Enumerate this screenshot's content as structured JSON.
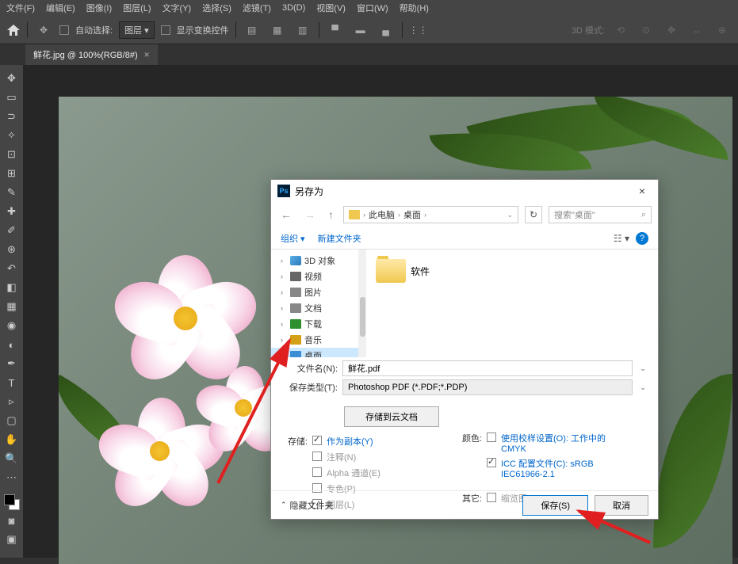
{
  "menubar": [
    "文件(F)",
    "编辑(E)",
    "图像(I)",
    "图层(L)",
    "文字(Y)",
    "选择(S)",
    "滤镜(T)",
    "3D(D)",
    "视图(V)",
    "窗口(W)",
    "帮助(H)"
  ],
  "toolbar": {
    "auto_select_label": "自动选择:",
    "layer_select": "图层",
    "show_transform": "显示变换控件",
    "mode_3d": "3D 模式:"
  },
  "document_tab": "鲜花.jpg @ 100%(RGB/8#)",
  "dialog": {
    "title": "另存为",
    "path": {
      "segments": [
        "此电脑",
        "桌面"
      ]
    },
    "search_placeholder": "搜索\"桌面\"",
    "organize": "组织",
    "new_folder": "新建文件夹",
    "tree": [
      {
        "label": "3D 对象",
        "icon": "ti-3d"
      },
      {
        "label": "视频",
        "icon": "ti-video"
      },
      {
        "label": "图片",
        "icon": "ti-pic"
      },
      {
        "label": "文档",
        "icon": "ti-doc"
      },
      {
        "label": "下载",
        "icon": "ti-down"
      },
      {
        "label": "音乐",
        "icon": "ti-music"
      },
      {
        "label": "桌面",
        "icon": "ti-desk",
        "selected": true
      }
    ],
    "file_area_folder": "软件",
    "filename_label": "文件名(N):",
    "filename_value": "鲜花.pdf",
    "filetype_label": "保存类型(T):",
    "filetype_value": "Photoshop PDF (*.PDF;*.PDP)",
    "cloud_save": "存储到云文档",
    "save_opts_label": "存储:",
    "save_opts": {
      "as_copy": "作为副本(Y)",
      "annotations": "注释(N)",
      "alpha": "Alpha 通道(E)",
      "spot": "专色(P)",
      "layers": "图层(L)"
    },
    "color_label": "颜色:",
    "color_opts": {
      "proof": "使用校样设置(O): 工作中的 CMYK",
      "icc": "ICC 配置文件(C): sRGB IEC61966-2.1"
    },
    "other_label": "其它:",
    "other_thumb": "缩览图(T)",
    "hide_folders": "隐藏文件夹",
    "save_btn": "保存(S)",
    "cancel_btn": "取消"
  }
}
